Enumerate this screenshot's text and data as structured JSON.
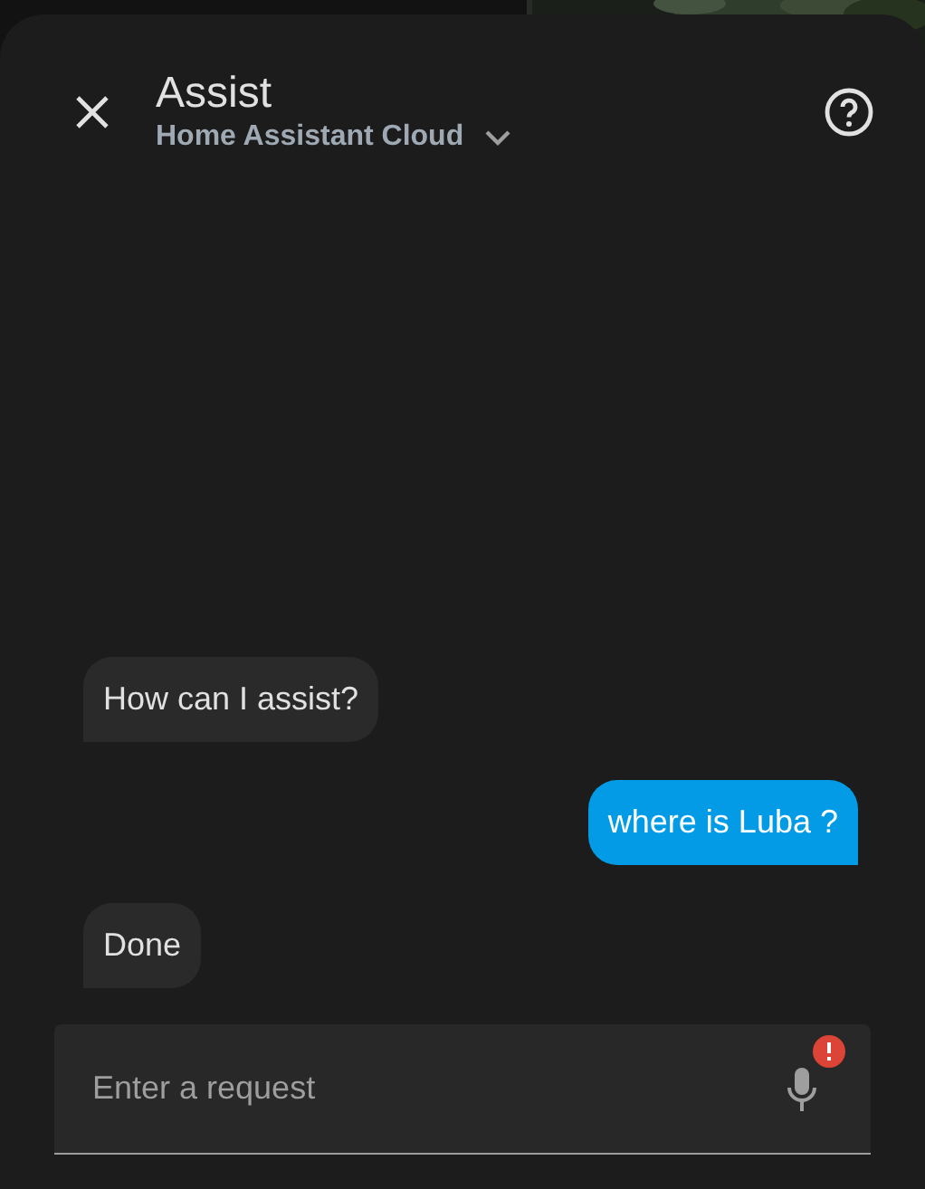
{
  "dialog": {
    "title": "Assist",
    "pipeline": "Home Assistant Cloud"
  },
  "messages": [
    {
      "kind": "assistant",
      "text": "How can I assist?"
    },
    {
      "kind": "user",
      "text": "where is Luba ?"
    },
    {
      "kind": "assistant",
      "text": "Done"
    }
  ],
  "input": {
    "placeholder": "Enter a request",
    "mic_error": true
  }
}
